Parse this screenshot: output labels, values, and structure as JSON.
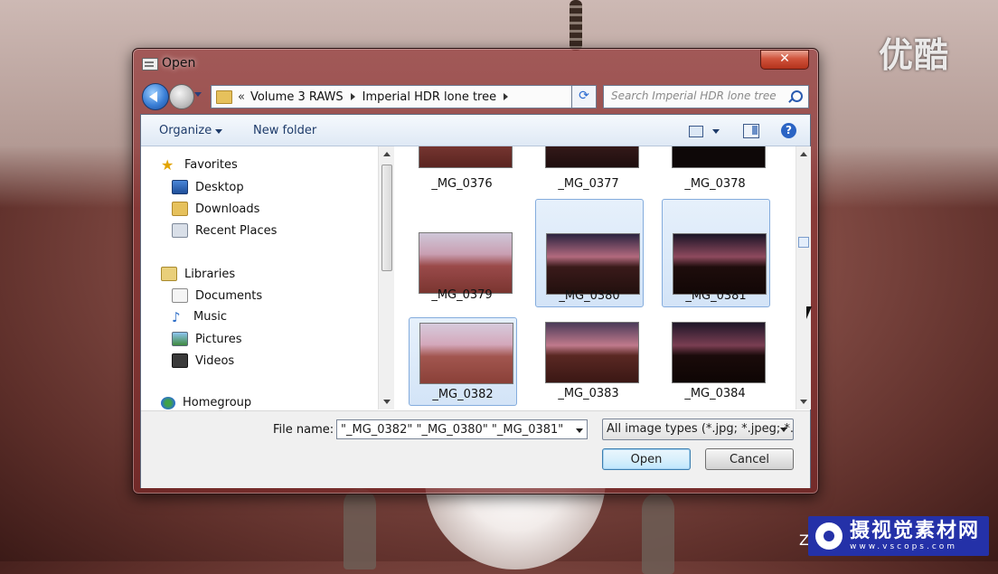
{
  "window": {
    "title": "Open",
    "close_glyph": "✕"
  },
  "address_bar": {
    "overflow_glyph": "«",
    "crumbs": [
      "Volume 3 RAWS",
      "Imperial HDR lone tree"
    ]
  },
  "search": {
    "placeholder": "Search Imperial HDR lone tree"
  },
  "toolbar": {
    "organize_label": "Organize",
    "new_folder_label": "New folder",
    "help_glyph": "?"
  },
  "nav_pane": {
    "items": [
      {
        "label": "Favorites",
        "icon": "star-icon"
      },
      {
        "label": "Desktop",
        "icon": "desktop-icon"
      },
      {
        "label": "Downloads",
        "icon": "downloads-icon"
      },
      {
        "label": "Recent Places",
        "icon": "recent-places-icon"
      },
      {
        "label": "Libraries",
        "icon": "libraries-icon"
      },
      {
        "label": "Documents",
        "icon": "documents-icon"
      },
      {
        "label": "Music",
        "icon": "music-icon"
      },
      {
        "label": "Pictures",
        "icon": "pictures-icon"
      },
      {
        "label": "Videos",
        "icon": "videos-icon"
      },
      {
        "label": "Homegroup",
        "icon": "homegroup-icon"
      }
    ]
  },
  "files": [
    {
      "name": "_MG_0376",
      "selected": false
    },
    {
      "name": "_MG_0377",
      "selected": false
    },
    {
      "name": "_MG_0378",
      "selected": false
    },
    {
      "name": "_MG_0379",
      "selected": false
    },
    {
      "name": "_MG_0380",
      "selected": true
    },
    {
      "name": "_MG_0381",
      "selected": true
    },
    {
      "name": "_MG_0382",
      "selected": true
    },
    {
      "name": "_MG_0383",
      "selected": false
    },
    {
      "name": "_MG_0384",
      "selected": false
    }
  ],
  "bottom": {
    "file_name_label": "File name:",
    "file_name_value": "\"_MG_0382\" \"_MG_0380\" \"_MG_0381\"",
    "file_type_value": "All image types (*.jpg; *.jpeg; *.",
    "open_label": "Open",
    "cancel_label": "Cancel"
  },
  "watermark": {
    "top_right": "优酷",
    "bottom_right_main": "摄视觉素材网",
    "bottom_right_sub": "www.vscops.com",
    "stray_char": "Z"
  },
  "colors": {
    "close_red": "#c9422a",
    "selection_blue": "#d3e4f7",
    "link_blue": "#1e3b6a"
  }
}
